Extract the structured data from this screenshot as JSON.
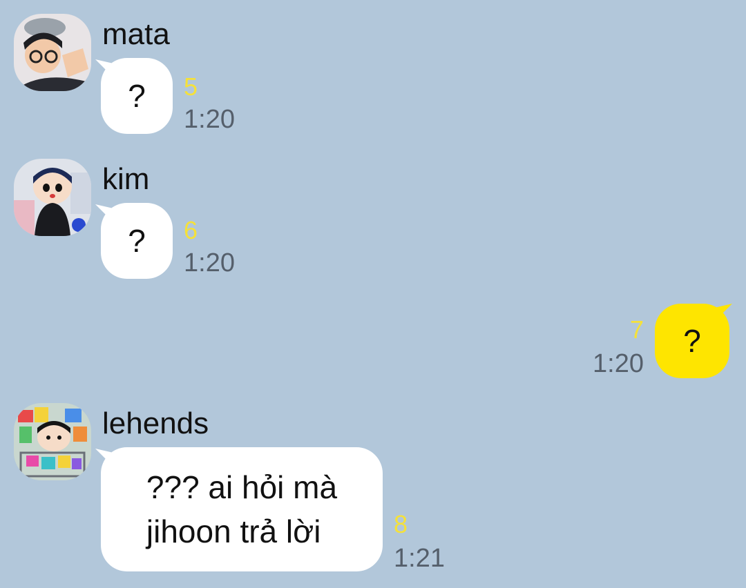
{
  "messages": [
    {
      "sender": "mata",
      "text": "?",
      "unread": "5",
      "time": "1:20",
      "avatar_icon": "person-glasses-avatar-icon"
    },
    {
      "sender": "kim",
      "text": "?",
      "unread": "6",
      "time": "1:20",
      "avatar_icon": "cartoon-boy-avatar-icon"
    },
    {
      "sender": "",
      "text": "?",
      "unread": "7",
      "time": "1:20",
      "mine": true
    },
    {
      "sender": "lehends",
      "text_lines": [
        "??? ai hỏi mà",
        "jihoon trả lời"
      ],
      "unread": "8",
      "time": "1:21",
      "avatar_icon": "cartoon-cart-avatar-icon"
    }
  ],
  "colors": {
    "background": "#b2c7da",
    "bubble_other": "#ffffff",
    "bubble_mine": "#fee500",
    "unread": "#f5e13a",
    "time": "#555f6b"
  }
}
